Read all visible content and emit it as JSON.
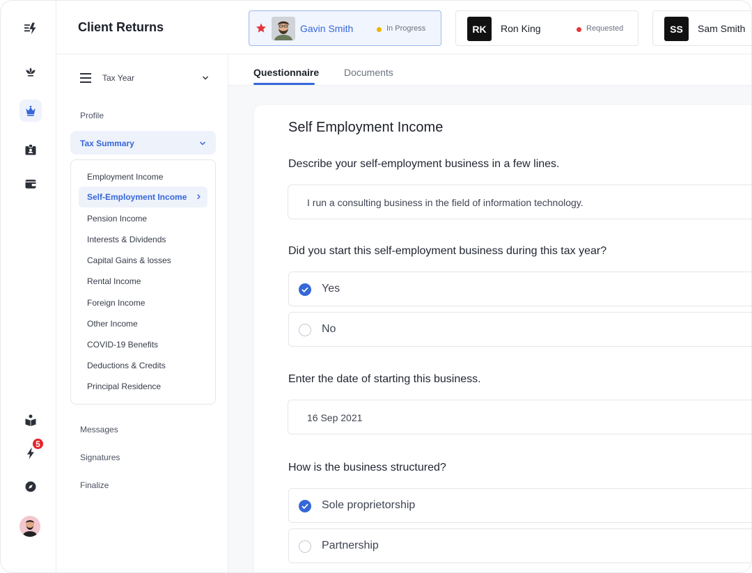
{
  "header": {
    "title": "Client Returns"
  },
  "clients": [
    {
      "name": "Gavin Smith",
      "status": "In Progress",
      "status_color": "#f0b400",
      "starred": true,
      "active": true
    },
    {
      "name": "Ron King",
      "initials": "RK",
      "status": "Requested",
      "status_color": "#e5353b"
    },
    {
      "name": "Sam Smith",
      "initials": "SS"
    }
  ],
  "rail": {
    "badge_count": "5"
  },
  "subnav": {
    "year_label": "Tax Year",
    "profile": "Profile",
    "tax_summary": "Tax Summary",
    "summary_items": [
      "Employment Income",
      "Self-Employment Income",
      "Pension Income",
      "Interests & Dividends",
      "Capital Gains & losses",
      "Rental Income",
      "Foreign Income",
      "Other Income",
      "COVID-19 Benefits",
      "Deductions & Credits",
      "Principal Residence"
    ],
    "messages": "Messages",
    "signatures": "Signatures",
    "finalize": "Finalize"
  },
  "tabs": {
    "questionnaire": "Questionnaire",
    "documents": "Documents"
  },
  "form": {
    "title": "Self Employment Income",
    "q1": "Describe your self-employment business in a few lines.",
    "q1_value": "I run a consulting business in the field of information technology.",
    "q2": "Did you start this self-employment business during this tax year?",
    "q2_options": [
      "Yes",
      "No"
    ],
    "q3": "Enter the date of starting this business.",
    "q3_value": "16 Sep 2021",
    "q4": "How is the business structured?",
    "q4_options": [
      "Sole proprietorship",
      "Partnership"
    ]
  },
  "colors": {
    "accent": "#3567d8",
    "badge": "#e5252a"
  }
}
